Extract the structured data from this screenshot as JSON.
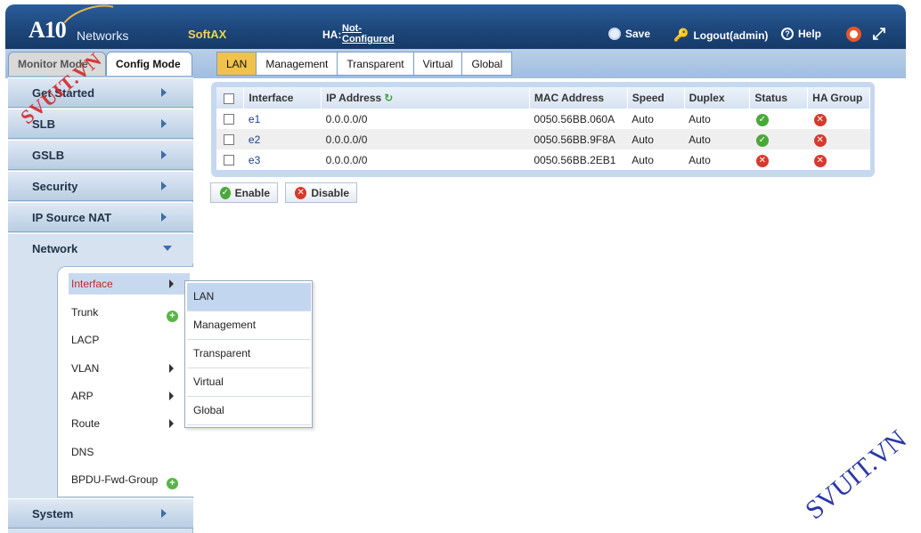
{
  "header": {
    "logo": "A10",
    "logo_sub": "Networks",
    "product": "SoftAX",
    "ha_label": "HA:",
    "ha_value": "Not-Configured",
    "save": "Save",
    "logout": "Logout(admin)",
    "help": "Help"
  },
  "mode_tabs": {
    "monitor": "Monitor Mode",
    "config": "Config Mode"
  },
  "sidebar": {
    "items": [
      {
        "label": "Get Started"
      },
      {
        "label": "SLB"
      },
      {
        "label": "GSLB"
      },
      {
        "label": "Security"
      },
      {
        "label": "IP Source NAT"
      },
      {
        "label": "Network"
      },
      {
        "label": "System"
      }
    ],
    "network_sub": [
      {
        "label": "Interface"
      },
      {
        "label": "Trunk"
      },
      {
        "label": "LACP"
      },
      {
        "label": "VLAN"
      },
      {
        "label": "ARP"
      },
      {
        "label": "Route"
      },
      {
        "label": "DNS"
      },
      {
        "label": "BPDU-Fwd-Group"
      }
    ]
  },
  "flyout": [
    {
      "label": "LAN"
    },
    {
      "label": "Management"
    },
    {
      "label": "Transparent"
    },
    {
      "label": "Virtual"
    },
    {
      "label": "Global"
    }
  ],
  "sub_tabs": [
    {
      "label": "LAN"
    },
    {
      "label": "Management"
    },
    {
      "label": "Transparent"
    },
    {
      "label": "Virtual"
    },
    {
      "label": "Global"
    }
  ],
  "table": {
    "columns": [
      "Interface",
      "IP Address",
      "MAC Address",
      "Speed",
      "Duplex",
      "Status",
      "HA Group"
    ],
    "rows": [
      {
        "interface": "e1",
        "ip": "0.0.0.0/0",
        "mac": "0050.56BB.060A",
        "speed": "Auto",
        "duplex": "Auto",
        "status": "up",
        "ha": "none"
      },
      {
        "interface": "e2",
        "ip": "0.0.0.0/0",
        "mac": "0050.56BB.9F8A",
        "speed": "Auto",
        "duplex": "Auto",
        "status": "up",
        "ha": "none"
      },
      {
        "interface": "e3",
        "ip": "0.0.0.0/0",
        "mac": "0050.56BB.2EB1",
        "speed": "Auto",
        "duplex": "Auto",
        "status": "down",
        "ha": "none"
      }
    ]
  },
  "actions": {
    "enable": "Enable",
    "disable": "Disable"
  },
  "watermarks": {
    "left": "SVUIT.VN",
    "right": "SVUIT.VN"
  },
  "colors": {
    "header": "#1d477c",
    "active_tab": "#f0c24c",
    "ok": "#4aa83a",
    "error": "#d63a2c",
    "active_sub": "#c6252b"
  }
}
